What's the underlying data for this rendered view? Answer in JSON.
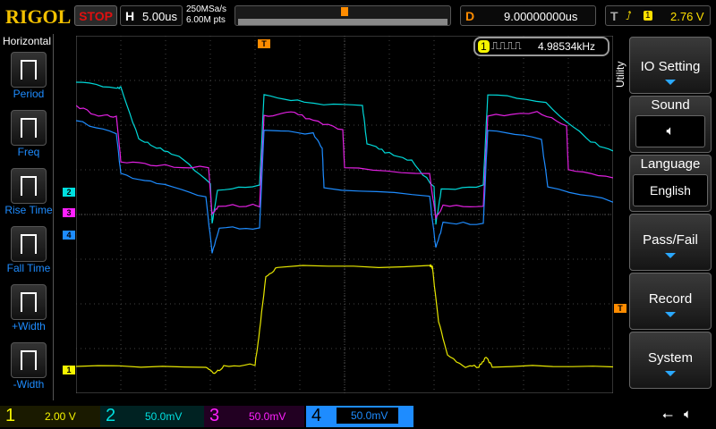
{
  "header": {
    "logo": "RIGOL",
    "run_state": "STOP",
    "h_label": "H",
    "timebase": "5.00us",
    "sample_rate": "250MSa/s",
    "memory_depth": "6.00M pts",
    "d_label": "D",
    "delay": "9.00000000us",
    "t_label": "T",
    "trigger_source": "1",
    "trigger_level": "2.76 V"
  },
  "left_menu": {
    "title": "Horizontal",
    "items": [
      {
        "label": "Period",
        "icon": "period-icon"
      },
      {
        "label": "Freq",
        "icon": "frequency-icon"
      },
      {
        "label": "Rise Time",
        "icon": "rise-time-icon"
      },
      {
        "label": "Fall Time",
        "icon": "fall-time-icon"
      },
      {
        "label": "+Width",
        "icon": "positive-width-icon"
      },
      {
        "label": "-Width",
        "icon": "negative-width-icon"
      }
    ]
  },
  "measurement": {
    "channel": "1",
    "value": "4.98534kHz"
  },
  "markers": {
    "ch1": "1",
    "ch2": "2",
    "ch3": "3",
    "ch4": "4",
    "trigger": "T"
  },
  "right_menu": {
    "title": "Utility",
    "items": [
      {
        "label": "IO Setting",
        "arrow": true
      },
      {
        "label": "Sound",
        "icon": "speaker-icon"
      },
      {
        "label": "Language",
        "value": "English"
      },
      {
        "label": "Pass/Fail",
        "arrow": true
      },
      {
        "label": "Record",
        "arrow": true
      },
      {
        "label": "System",
        "arrow": true
      }
    ]
  },
  "channels": [
    {
      "num": "1",
      "scale": "2.00 V",
      "color": "#f5f500"
    },
    {
      "num": "2",
      "scale": "50.0mV",
      "color": "#00e0e0"
    },
    {
      "num": "3",
      "scale": "50.0mV",
      "color": "#ff20ff"
    },
    {
      "num": "4",
      "scale": "50.0mV",
      "color": "#1e8cff"
    }
  ],
  "colors": {
    "accent": "#1e8cff",
    "trigger": "#ff8c00",
    "stop": "#e01010"
  }
}
